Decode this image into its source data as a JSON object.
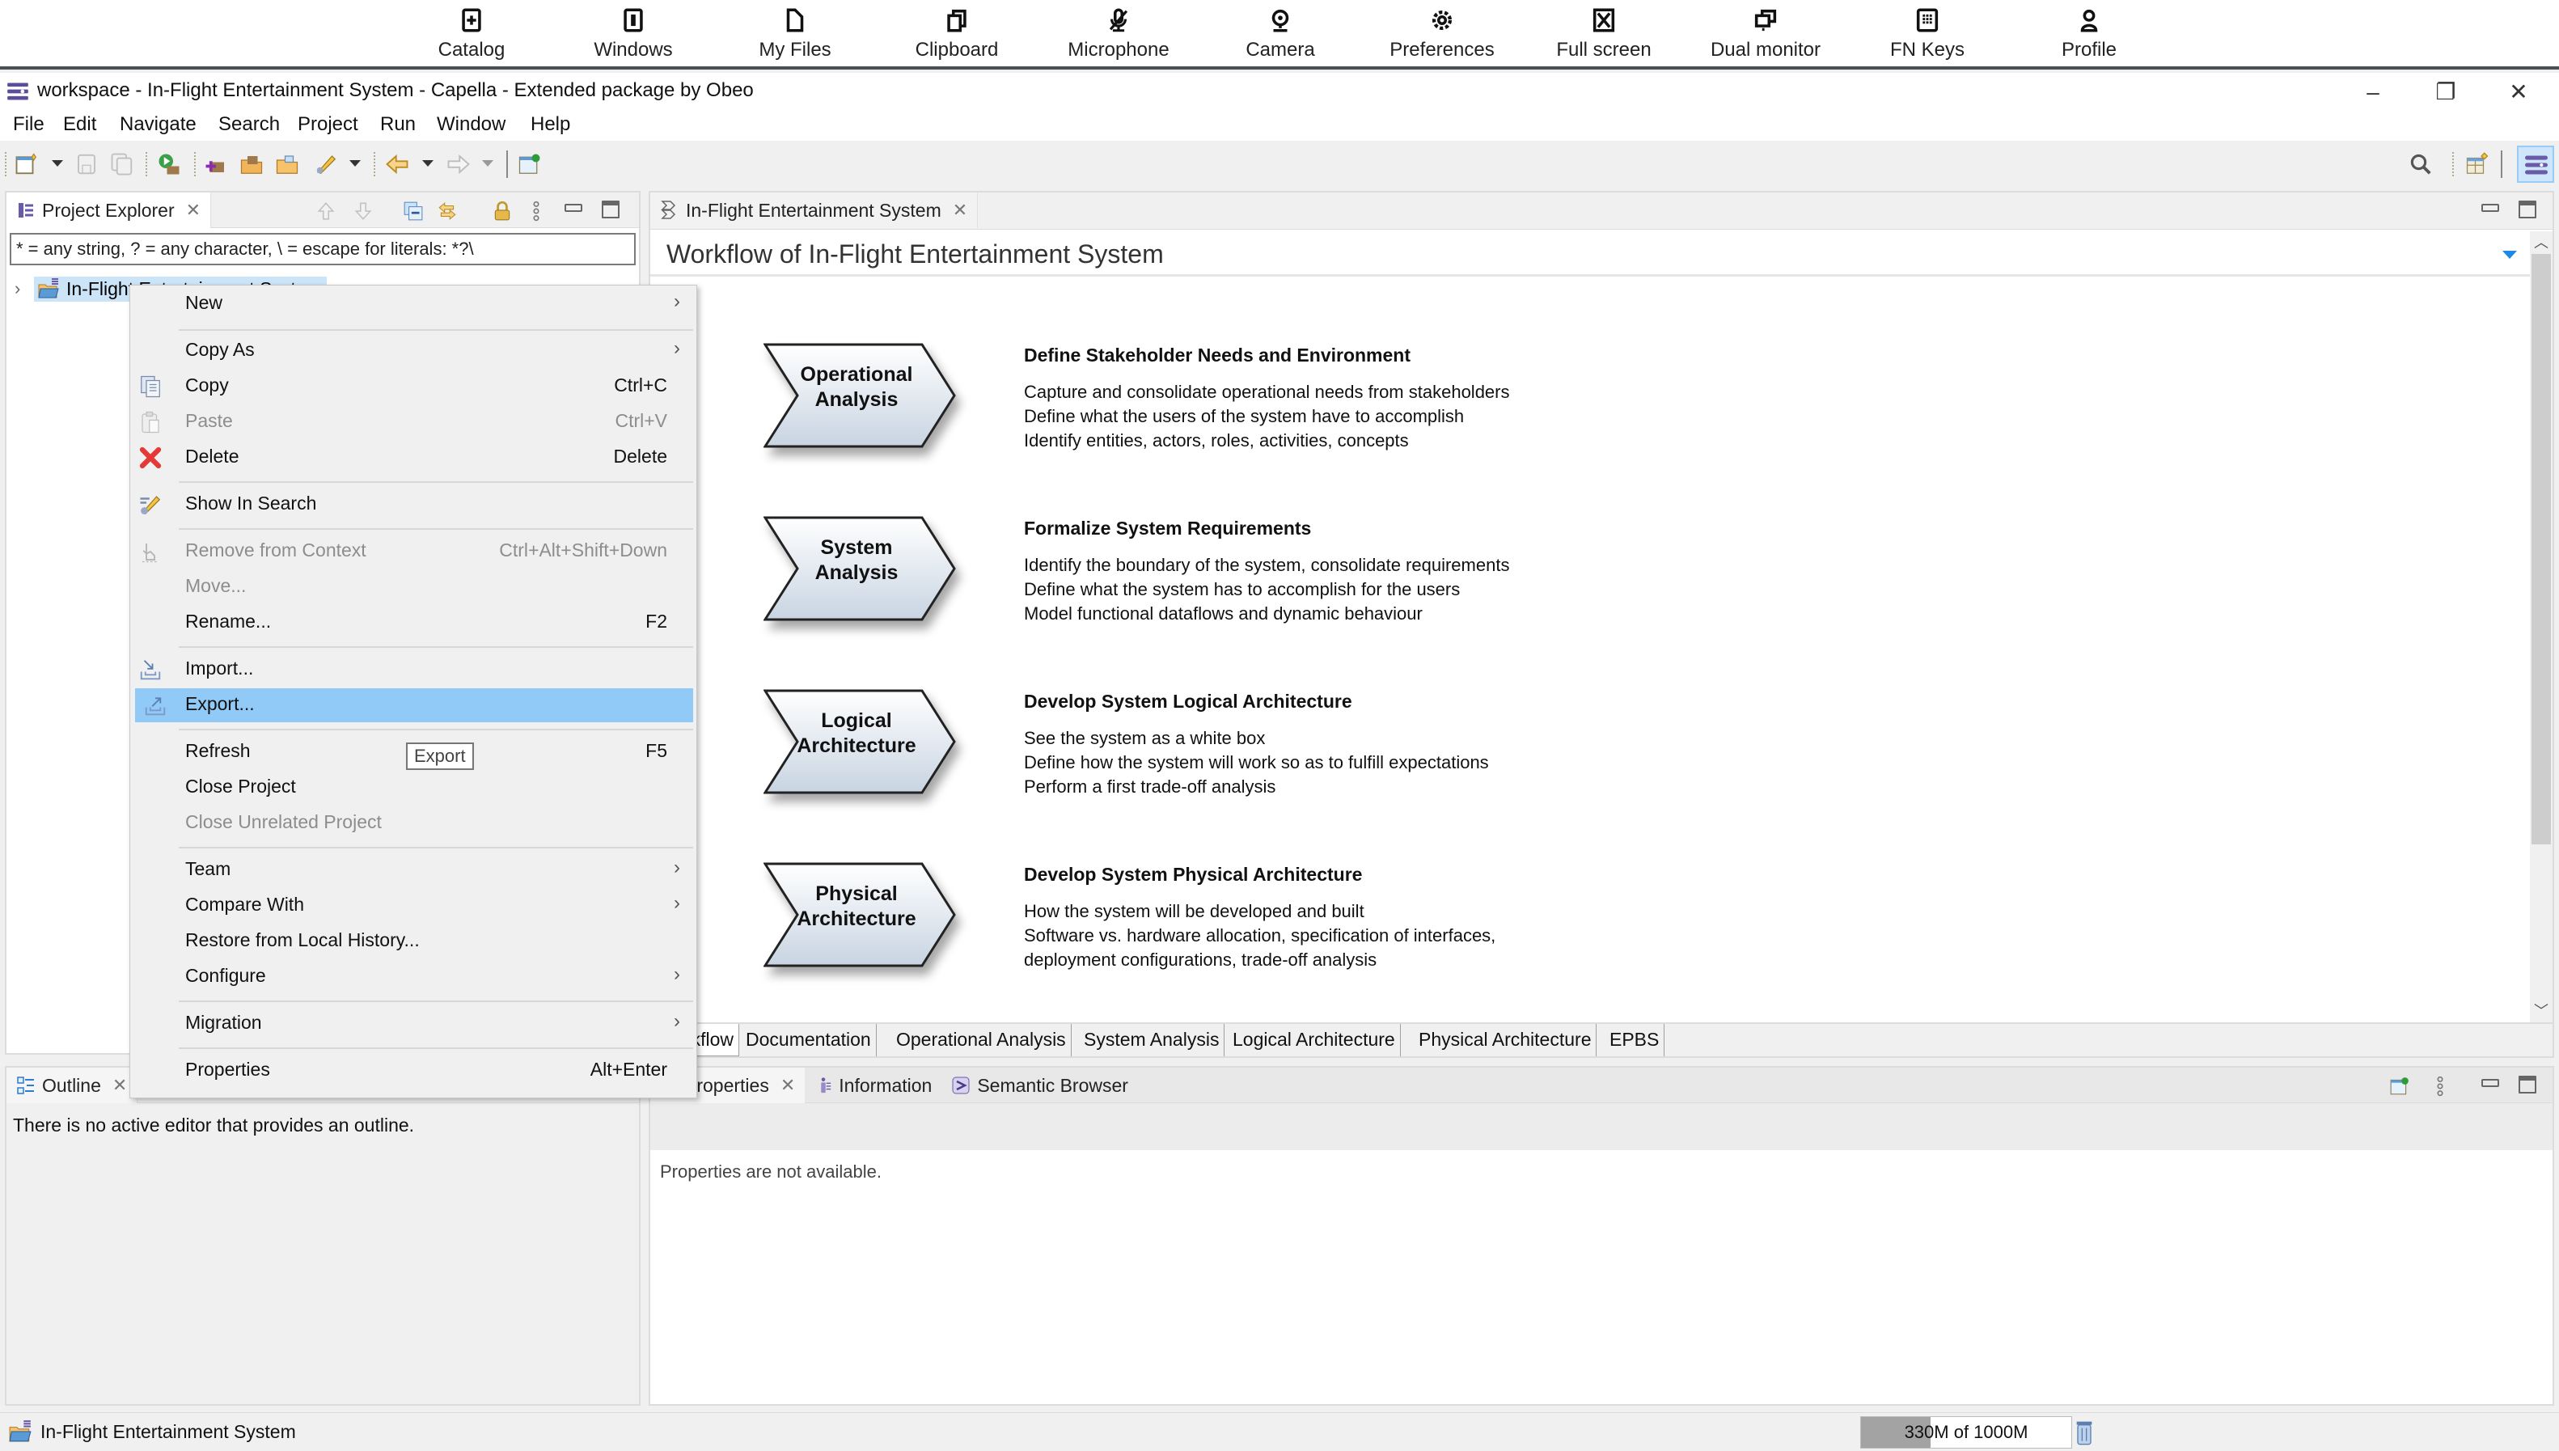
{
  "topbar": {
    "items": [
      {
        "label": "Catalog",
        "icon": "catalog-icon"
      },
      {
        "label": "Windows",
        "icon": "windows-icon"
      },
      {
        "label": "My Files",
        "icon": "file-icon"
      },
      {
        "label": "Clipboard",
        "icon": "clipboard-icon"
      },
      {
        "label": "Microphone",
        "icon": "microphone-icon"
      },
      {
        "label": "Camera",
        "icon": "camera-icon"
      },
      {
        "label": "Preferences",
        "icon": "gear-icon"
      },
      {
        "label": "Full screen",
        "icon": "fullscreen-icon"
      },
      {
        "label": "Dual monitor",
        "icon": "dual-monitor-icon"
      },
      {
        "label": "FN Keys",
        "icon": "keyboard-icon"
      },
      {
        "label": "Profile",
        "icon": "user-icon"
      }
    ]
  },
  "window": {
    "title": "workspace - In-Flight Entertainment System - Capella - Extended package by Obeo",
    "controls": {
      "minimize": "–",
      "restore": "❐",
      "close": "✕"
    }
  },
  "menubar": [
    "File",
    "Edit",
    "Navigate",
    "Search",
    "Project",
    "Run",
    "Window",
    "Help"
  ],
  "project_explorer": {
    "tab_label": "Project Explorer",
    "filter_value": "* = any string, ? = any character, \\ = escape for literals: *?\\",
    "tree": [
      {
        "label": "In-Flight Entertainment System",
        "expanded": false,
        "selected": true
      }
    ]
  },
  "outline": {
    "tab_label": "Outline",
    "message": "There is no active editor that provides an outline."
  },
  "editor": {
    "tab_label": "In-Flight Entertainment System",
    "workflow_title": "Workflow of In-Flight Entertainment System",
    "steps": [
      {
        "chevron_lines": [
          "Operational",
          "Analysis"
        ],
        "heading": "Define Stakeholder Needs and Environment",
        "lines": [
          "Capture and consolidate operational needs from stakeholders",
          "Define what the users of the system have to accomplish",
          "Identify entities, actors, roles, activities, concepts"
        ]
      },
      {
        "chevron_lines": [
          "System",
          "Analysis"
        ],
        "heading": "Formalize System Requirements",
        "lines": [
          "Identify the boundary of the system, consolidate requirements",
          "Define what the system has to accomplish for the users",
          "Model functional dataflows and dynamic behaviour"
        ]
      },
      {
        "chevron_lines": [
          "Logical",
          "Architecture"
        ],
        "heading": "Develop System Logical Architecture",
        "lines": [
          "See the system as a white box",
          "Define how the system will work so as to fulfill expectations",
          "Perform a first trade-off analysis"
        ]
      },
      {
        "chevron_lines": [
          "Physical",
          "Architecture"
        ],
        "heading": "Develop System Physical Architecture",
        "lines": [
          "How the system will be developed and built",
          "Software vs. hardware allocation, specification of interfaces,",
          "deployment configurations, trade-off analysis"
        ]
      }
    ],
    "bottom_tabs": [
      {
        "label": "Workflow",
        "active": true
      },
      {
        "label": "Documentation",
        "active": false
      },
      {
        "label": "Operational Analysis",
        "active": false
      },
      {
        "label": "System Analysis",
        "active": false
      },
      {
        "label": "Logical Architecture",
        "active": false
      },
      {
        "label": "Physical Architecture",
        "active": false
      },
      {
        "label": "EPBS",
        "active": false
      }
    ],
    "scroll_fraction": 0.0
  },
  "properties_view": {
    "tabs": [
      {
        "label": "Properties",
        "icon": "properties-icon",
        "active": true
      },
      {
        "label": "Information",
        "icon": "information-icon",
        "active": false
      },
      {
        "label": "Semantic Browser",
        "icon": "semantic-browser-icon",
        "active": false
      }
    ],
    "message": "Properties are not available."
  },
  "status_bar": {
    "selection": "In-Flight Entertainment System",
    "heap_text": "330M of 1000M",
    "heap_used_mb": 330,
    "heap_total_mb": 1000
  },
  "context_menu": {
    "items": [
      {
        "label": "New",
        "submenu": true
      },
      {
        "separator": true
      },
      {
        "label": "Copy As",
        "submenu": true
      },
      {
        "label": "Copy",
        "shortcut": "Ctrl+C",
        "icon": "copy-icon"
      },
      {
        "label": "Paste",
        "shortcut": "Ctrl+V",
        "icon": "paste-icon",
        "disabled": true
      },
      {
        "label": "Delete",
        "shortcut": "Delete",
        "icon": "delete-icon"
      },
      {
        "separator": true
      },
      {
        "label": "Show In Search",
        "icon": "search-pen-icon"
      },
      {
        "separator": true
      },
      {
        "label": "Remove from Context",
        "shortcut": "Ctrl+Alt+Shift+Down",
        "icon": "remove-context-icon",
        "disabled": true
      },
      {
        "label": "Move...",
        "disabled": true
      },
      {
        "label": "Rename...",
        "shortcut": "F2"
      },
      {
        "separator": true
      },
      {
        "label": "Import...",
        "icon": "import-icon"
      },
      {
        "label": "Export...",
        "icon": "export-icon",
        "highlighted": true
      },
      {
        "separator": true
      },
      {
        "label": "Refresh",
        "shortcut": "F5"
      },
      {
        "label": "Close Project"
      },
      {
        "label": "Close Unrelated Project",
        "disabled": true
      },
      {
        "separator": true
      },
      {
        "label": "Team",
        "submenu": true
      },
      {
        "label": "Compare With",
        "submenu": true
      },
      {
        "label": "Restore from Local History..."
      },
      {
        "label": "Configure",
        "submenu": true
      },
      {
        "separator": true
      },
      {
        "label": "Migration",
        "submenu": true
      },
      {
        "separator": true
      },
      {
        "label": "Properties",
        "shortcut": "Alt+Enter"
      }
    ],
    "tooltip": "Export"
  },
  "colors": {
    "selection_highlight": "#91c9f7",
    "tree_selection": "#cce4f7",
    "accent_blue": "#1e88e5",
    "delete_red": "#e53935"
  }
}
